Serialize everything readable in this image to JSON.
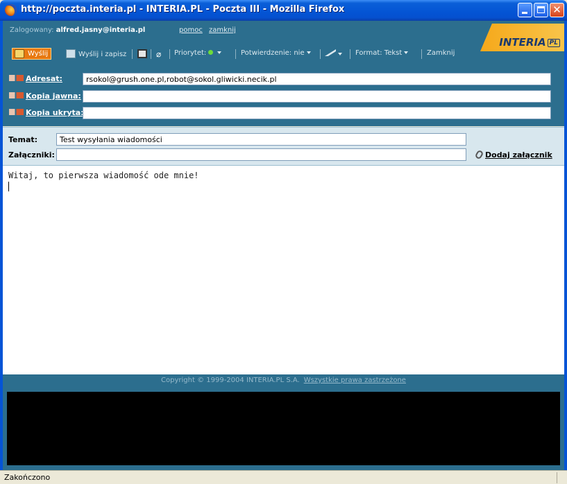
{
  "window": {
    "title": "http://poczta.interia.pl - INTERIA.PL - Poczta III - Mozilla Firefox"
  },
  "header": {
    "logged_label": "Zalogowany:",
    "user": "alfred.jasny@interia.pl",
    "links": [
      "pomoc",
      "zamknij"
    ],
    "logo": "INTERIA",
    "logo_suffix": "PL"
  },
  "toolbar": {
    "send": "Wyślij",
    "send_save": "Wyślij i zapisz",
    "priority": "Priorytet:",
    "confirm": "Potwierdzenie: nie",
    "format": "Format: Tekst",
    "close": "Zamknij"
  },
  "address": {
    "to_label": "Adresat:",
    "to_value": "rsokol@grush.one.pl,robot@sokol.gliwicki.necik.pl",
    "cc_label": "Kopia jawna:",
    "cc_value": "",
    "bcc_label": "Kopia ukryta:",
    "bcc_value": ""
  },
  "subject": {
    "subject_label": "Temat:",
    "subject_value": "Test wysyłania wiadomości",
    "attach_label": "Załączniki:",
    "attach_value": "",
    "add_attachment": "Dodaj załącznik"
  },
  "body": {
    "text": "Witaj, to pierwsza wiadomość ode mnie!"
  },
  "footer": {
    "copyright": "Copyright © 1999-2004 INTERIA.PL S.A.",
    "rights": "Wszystkie prawa zastrzeżone"
  },
  "status": {
    "text": "Zakończono"
  },
  "colors": {
    "panel": "#2c6e8e",
    "accent": "#e87910",
    "titlebar": "#0454d4"
  }
}
